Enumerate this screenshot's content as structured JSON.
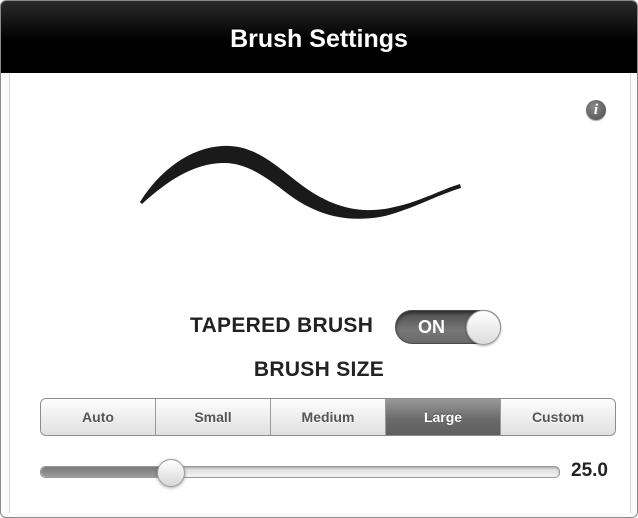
{
  "title": "Brush Settings",
  "info_icon": "info-icon",
  "brush_preview_icon": "brush-stroke-preview",
  "tapered_brush": {
    "label": "TAPERED BRUSH",
    "toggle_text": "ON",
    "on": true
  },
  "brush_size": {
    "label": "BRUSH SIZE",
    "options": [
      "Auto",
      "Small",
      "Medium",
      "Large",
      "Custom"
    ],
    "selected": "Large"
  },
  "slider": {
    "value": "25.0",
    "level_fraction": 0.25
  },
  "colors": {
    "title_bar": "#000000",
    "selected_segment": "#6b6b6b",
    "toggle_on": "#6a6a6a",
    "stroke": "#1a1a1a"
  }
}
